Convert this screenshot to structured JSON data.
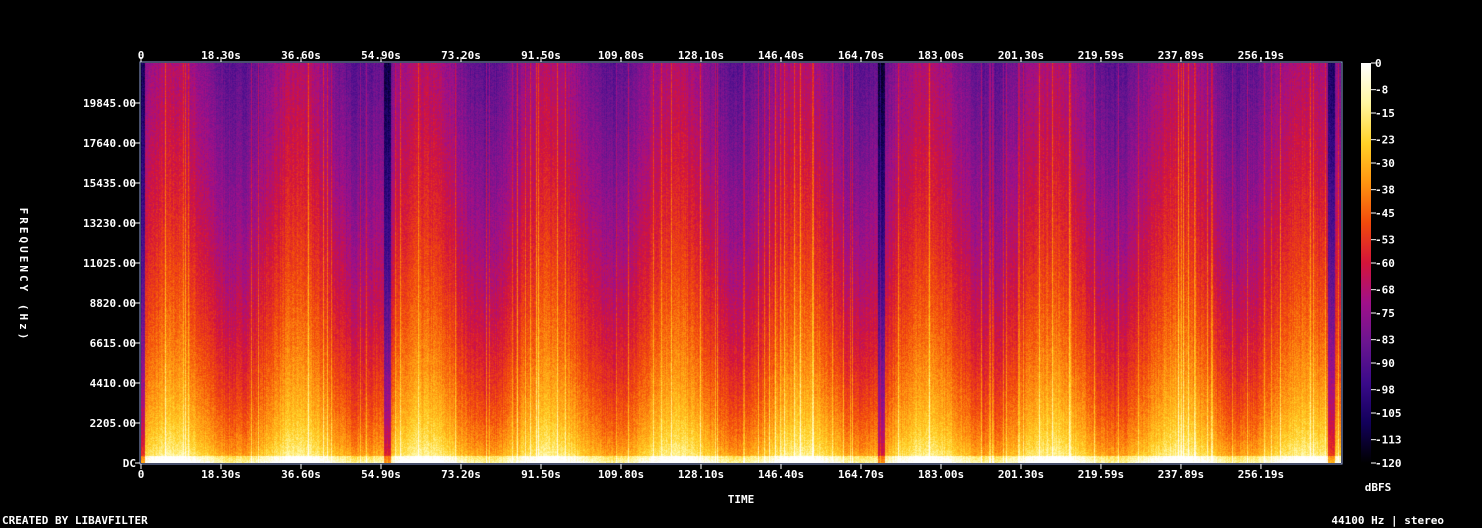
{
  "footer": {
    "left": "CREATED BY LIBAVFILTER",
    "right": "44100 Hz | stereo"
  },
  "chart_data": {
    "type": "heatmap",
    "title": "",
    "xlabel": "TIME",
    "ylabel": "FREQUENCY (Hz)",
    "colorbar_label": "dBFS",
    "x_ticks": [
      "0",
      "18.30s",
      "36.60s",
      "54.90s",
      "73.20s",
      "91.50s",
      "109.80s",
      "128.10s",
      "146.40s",
      "164.70s",
      "183.00s",
      "201.30s",
      "219.59s",
      "237.89s",
      "256.19s"
    ],
    "x_tick_values": [
      0,
      18.3,
      36.6,
      54.9,
      73.2,
      91.5,
      109.8,
      128.1,
      146.4,
      164.7,
      183.0,
      201.3,
      219.59,
      237.89,
      256.19
    ],
    "xlim": [
      0,
      274.5
    ],
    "y_ticks": [
      "DC",
      "2205.00",
      "4410.00",
      "6615.00",
      "8820.00",
      "11025.00",
      "13230.00",
      "15435.00",
      "17640.00",
      "19845.00"
    ],
    "y_tick_values": [
      0,
      2205,
      4410,
      6615,
      8820,
      11025,
      13230,
      15435,
      17640,
      19845
    ],
    "ylim": [
      0,
      22050
    ],
    "colorbar_ticks": [
      "0",
      "-8",
      "-15",
      "-23",
      "-30",
      "-38",
      "-45",
      "-53",
      "-60",
      "-68",
      "-75",
      "-83",
      "-90",
      "-98",
      "-105",
      "-113",
      "-120"
    ],
    "colorbar_values": [
      0,
      -8,
      -15,
      -23,
      -30,
      -38,
      -45,
      -53,
      -60,
      -68,
      -75,
      -83,
      -90,
      -98,
      -105,
      -113,
      -120
    ],
    "zlim": [
      -120,
      0
    ],
    "colormap": [
      "#000000",
      "#12005a",
      "#3a0a8a",
      "#6a1590",
      "#a0108a",
      "#d4143a",
      "#f24a0c",
      "#ff9410",
      "#ffd228",
      "#fff7a0",
      "#ffffff"
    ],
    "frame_color": "#8fa0d8"
  }
}
